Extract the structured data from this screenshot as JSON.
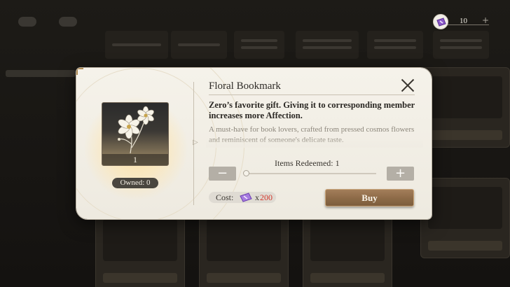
{
  "currency": {
    "icon": "ticket-icon",
    "amount": "10",
    "add_label": "+"
  },
  "dialog": {
    "title": "Floral Bookmark",
    "item": {
      "icon": "flower-bookmark-icon",
      "count": "1",
      "owned_label": "Owned: 0"
    },
    "description_main": "Zero’s favorite gift. Giving it to corresponding member increases more Affection.",
    "description_sub": "A must-have for book lovers, crafted from pressed cosmos flowers and reminiscent of someone's delicate taste.",
    "redeem": {
      "label": "Items Redeemed:",
      "value": "1",
      "minus_label": "−",
      "plus_label": "+"
    },
    "cost": {
      "label": "Cost:",
      "icon": "ticket-icon",
      "multiplier": "x",
      "value": "200",
      "value_color": "#d4372b"
    },
    "buy_label": "Buy"
  },
  "colors": {
    "accent_brown": "#8c6a47",
    "panel_bg": "#f5f2ea"
  }
}
